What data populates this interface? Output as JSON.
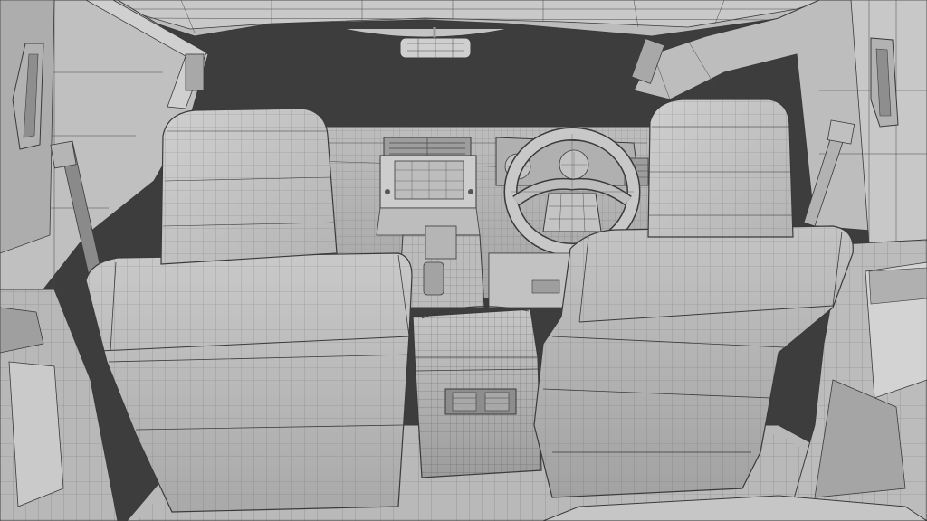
{
  "scene": {
    "subject": "",
    "render_mode": "wireframe-on-shaded",
    "colors": {
      "background": "#3d3d3d",
      "surface_light": "#d2d2d2",
      "surface_mid": "#b7b7b7",
      "surface_dark": "#8c8c8c",
      "wire": "#3a3a3a",
      "glass_void": "#3b3b3b"
    },
    "objects": [
      "roof-frame-mesh",
      "windshield-void",
      "rearview-mirror-mesh",
      "left-a-pillar-mesh",
      "right-a-pillar-mesh",
      "left-grab-handle-mesh",
      "right-grab-handle-mesh",
      "dashboard-mesh",
      "infotainment-screen-mesh",
      "center-vents-mesh",
      "instrument-cluster-mesh",
      "steering-wheel-mesh",
      "gear-shifter-mesh",
      "center-console-mesh",
      "rear-vent-mesh",
      "left-seat-headrest-mesh",
      "left-seat-back-mesh",
      "right-seat-headrest-mesh",
      "right-seat-back-mesh",
      "left-seatbelt-mesh",
      "right-seatbelt-mesh",
      "left-door-panel-mesh",
      "right-door-panel-mesh",
      "floor-mesh"
    ]
  }
}
